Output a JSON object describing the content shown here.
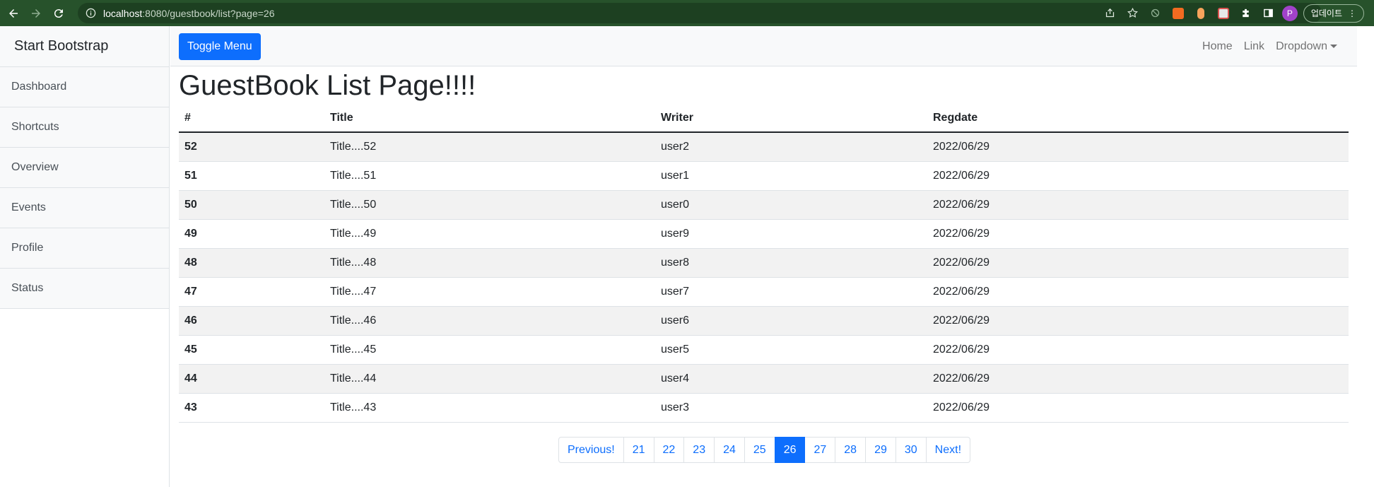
{
  "browser": {
    "url_host": "localhost",
    "url_rest": ":8080/guestbook/list?page=26",
    "update_label": "업데이트",
    "profile_initial": "P"
  },
  "sidebar": {
    "heading": "Start Bootstrap",
    "items": [
      {
        "label": "Dashboard"
      },
      {
        "label": "Shortcuts"
      },
      {
        "label": "Overview"
      },
      {
        "label": "Events"
      },
      {
        "label": "Profile"
      },
      {
        "label": "Status"
      }
    ]
  },
  "navbar": {
    "toggle_label": "Toggle Menu",
    "links": [
      "Home",
      "Link",
      "Dropdown"
    ]
  },
  "page": {
    "title": "GuestBook List Page!!!!"
  },
  "table": {
    "headers": [
      "#",
      "Title",
      "Writer",
      "Regdate"
    ],
    "rows": [
      [
        "52",
        "Title....52",
        "user2",
        "2022/06/29"
      ],
      [
        "51",
        "Title....51",
        "user1",
        "2022/06/29"
      ],
      [
        "50",
        "Title....50",
        "user0",
        "2022/06/29"
      ],
      [
        "49",
        "Title....49",
        "user9",
        "2022/06/29"
      ],
      [
        "48",
        "Title....48",
        "user8",
        "2022/06/29"
      ],
      [
        "47",
        "Title....47",
        "user7",
        "2022/06/29"
      ],
      [
        "46",
        "Title....46",
        "user6",
        "2022/06/29"
      ],
      [
        "45",
        "Title....45",
        "user5",
        "2022/06/29"
      ],
      [
        "44",
        "Title....44",
        "user4",
        "2022/06/29"
      ],
      [
        "43",
        "Title....43",
        "user3",
        "2022/06/29"
      ]
    ]
  },
  "pagination": {
    "previous": "Previous!",
    "pages": [
      "21",
      "22",
      "23",
      "24",
      "25",
      "26",
      "27",
      "28",
      "29",
      "30"
    ],
    "active": "26",
    "next": "Next!"
  },
  "colors": {
    "primary": "#0d6efd",
    "chrome_bg": "#27522b"
  }
}
